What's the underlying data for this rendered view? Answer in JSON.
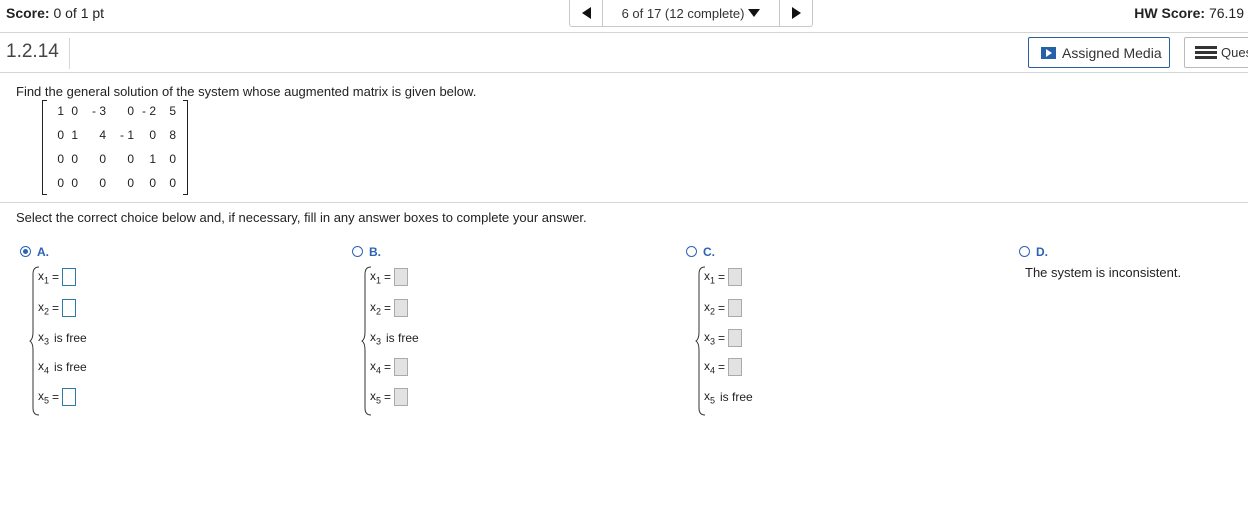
{
  "header": {
    "score_label": "Score:",
    "score_value": "0 of 1 pt",
    "progress": "6 of 17 (12 complete)",
    "hw_label": "HW Score:",
    "hw_value": "76.19"
  },
  "question": {
    "number": "1.2.14",
    "assigned_media_label": "Assigned Media",
    "questions_label": "Ques",
    "prompt": "Find the general solution of the system whose augmented matrix is given below.",
    "instructions": "Select the correct choice below and, if necessary, fill in any answer boxes to complete your answer."
  },
  "matrix": [
    [
      "1",
      "0",
      "-3",
      "0",
      "-2",
      "5"
    ],
    [
      "0",
      "1",
      "4",
      "-1",
      "0",
      "8"
    ],
    [
      "0",
      "0",
      "0",
      "0",
      "1",
      "0"
    ],
    [
      "0",
      "0",
      "0",
      "0",
      "0",
      "0"
    ]
  ],
  "choices": [
    {
      "letter": "A.",
      "selected": true,
      "rows": [
        {
          "var": "x",
          "sub": "1",
          "text": "=",
          "box": "blue"
        },
        {
          "var": "x",
          "sub": "2",
          "text": "=",
          "box": "blue"
        },
        {
          "var": "x",
          "sub": "3",
          "text": "is free",
          "box": ""
        },
        {
          "var": "x",
          "sub": "4",
          "text": "is free",
          "box": ""
        },
        {
          "var": "x",
          "sub": "5",
          "text": "=",
          "box": "blue"
        }
      ]
    },
    {
      "letter": "B.",
      "selected": false,
      "rows": [
        {
          "var": "x",
          "sub": "1",
          "text": "=",
          "box": "gray"
        },
        {
          "var": "x",
          "sub": "2",
          "text": "=",
          "box": "gray"
        },
        {
          "var": "x",
          "sub": "3",
          "text": "is free",
          "box": ""
        },
        {
          "var": "x",
          "sub": "4",
          "text": "=",
          "box": "gray"
        },
        {
          "var": "x",
          "sub": "5",
          "text": "=",
          "box": "gray"
        }
      ]
    },
    {
      "letter": "C.",
      "selected": false,
      "rows": [
        {
          "var": "x",
          "sub": "1",
          "text": "=",
          "box": "gray"
        },
        {
          "var": "x",
          "sub": "2",
          "text": "=",
          "box": "gray"
        },
        {
          "var": "x",
          "sub": "3",
          "text": "=",
          "box": "gray"
        },
        {
          "var": "x",
          "sub": "4",
          "text": "=",
          "box": "gray"
        },
        {
          "var": "x",
          "sub": "5",
          "text": "is free",
          "box": ""
        }
      ]
    },
    {
      "letter": "D.",
      "selected": false,
      "text": "The system is inconsistent."
    }
  ],
  "colors": {
    "accent": "#2c62b5",
    "border": "#d5d5d5"
  }
}
